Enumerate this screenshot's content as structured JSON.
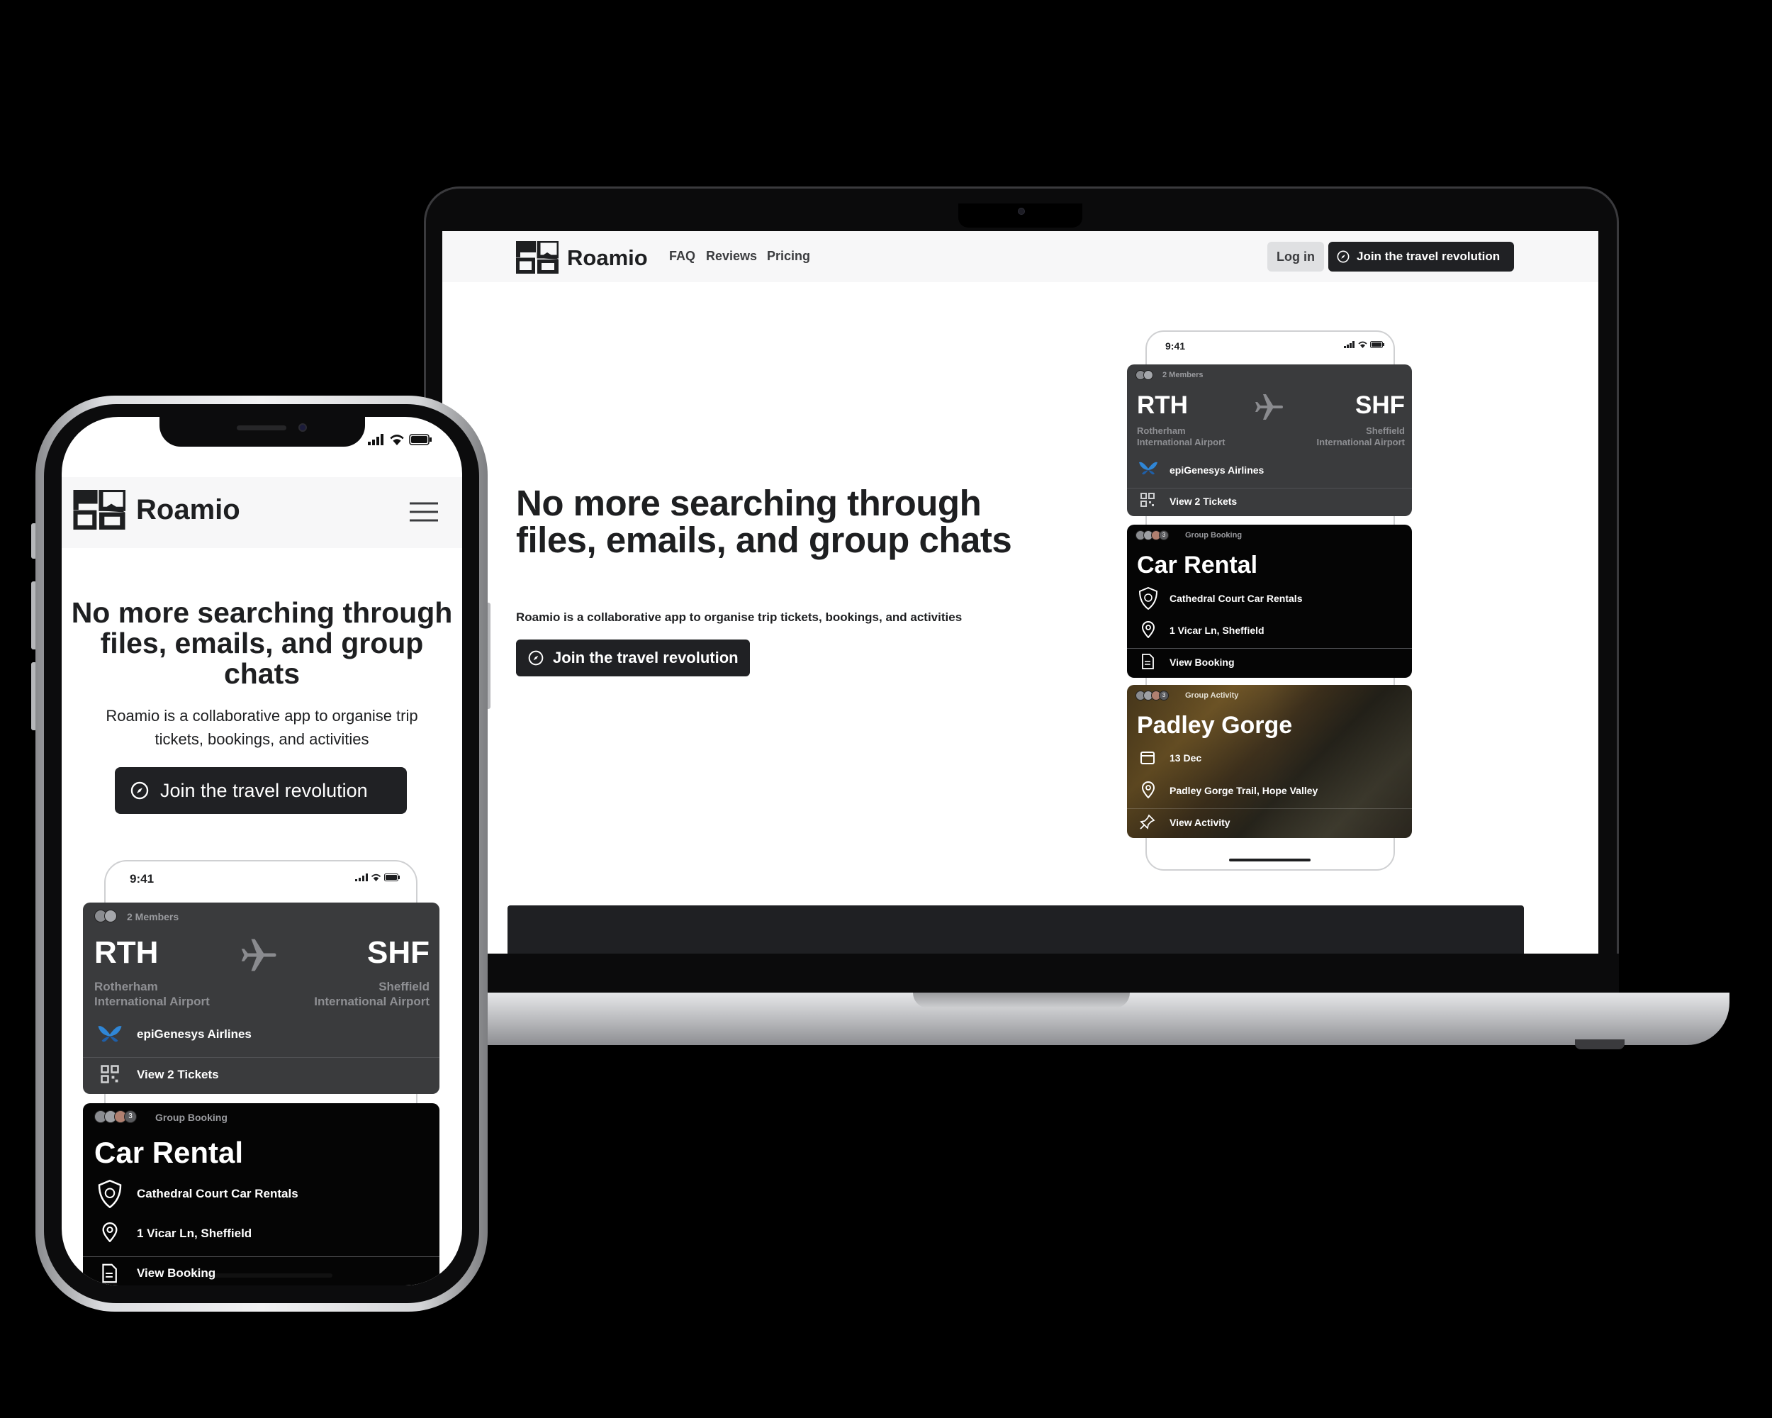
{
  "brand": "Roamio",
  "web": {
    "nav": {
      "links": [
        "FAQ",
        "Reviews",
        "Pricing"
      ],
      "login": "Log in",
      "cta": "Join the travel revolution"
    },
    "hero": {
      "title": "No more searching through files, emails, and group chats",
      "subtitle": "Roamio is a collaborative app to organise trip tickets, bookings, and activities",
      "cta": "Join the travel revolution"
    }
  },
  "mock": {
    "time": "9:41",
    "flight": {
      "members": "2 Members",
      "from_code": "RTH",
      "from_name_1": "Rotherham",
      "from_name_2": "International Airport",
      "to_code": "SHF",
      "to_name_1": "Sheffield",
      "to_name_2": "International Airport",
      "airline": "epiGenesys Airlines",
      "action": "View 2 Tickets"
    },
    "car": {
      "count": "3",
      "tag": "Group Booking",
      "title": "Car Rental",
      "company": "Cathedral Court Car Rentals",
      "address": "1 Vicar Ln, Sheffield",
      "action": "View Booking"
    },
    "activity": {
      "count": "3",
      "tag": "Group Activity",
      "title": "Padley Gorge",
      "date": "13 Dec",
      "address": "Padley Gorge Trail, Hope Valley",
      "action": "View Activity"
    }
  },
  "icons": [
    "compass-icon",
    "plane-icon",
    "butterfly-icon",
    "qr-icon",
    "shield-icon",
    "pin-icon",
    "document-icon",
    "calendar-icon",
    "pushpin-icon",
    "menu-icon",
    "signal-icon",
    "wifi-icon",
    "battery-icon"
  ],
  "colors": {
    "dark": "#202124",
    "card_grey": "#3a3b3d",
    "nav_bg": "#f7f7f8",
    "airline_blue": "#2f86d6"
  }
}
